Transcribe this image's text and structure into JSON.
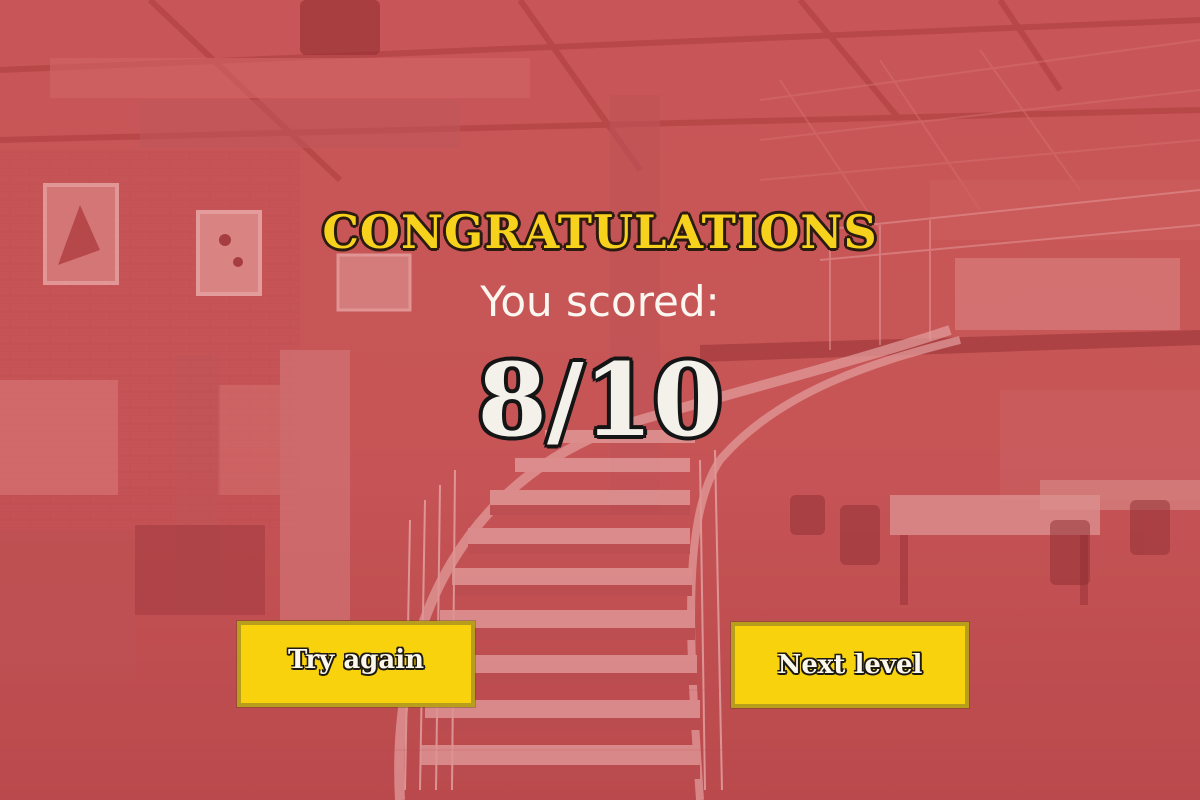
{
  "result_screen": {
    "headline": "CONGRATULATIONS",
    "score_label": "You scored:",
    "score_text": "8/10",
    "score": {
      "correct": 8,
      "total": 10
    }
  },
  "actions": {
    "try_again_label": "Try again",
    "next_level_label": "Next level"
  },
  "background": {
    "scene": "industrial loft office with spiral staircase",
    "overlay_color": "#d6464a"
  },
  "colors": {
    "headline": "#f6d21c",
    "button_fill": "#f9d20e",
    "button_border": "#b89e1c",
    "score_text": "#f4f1ea"
  }
}
